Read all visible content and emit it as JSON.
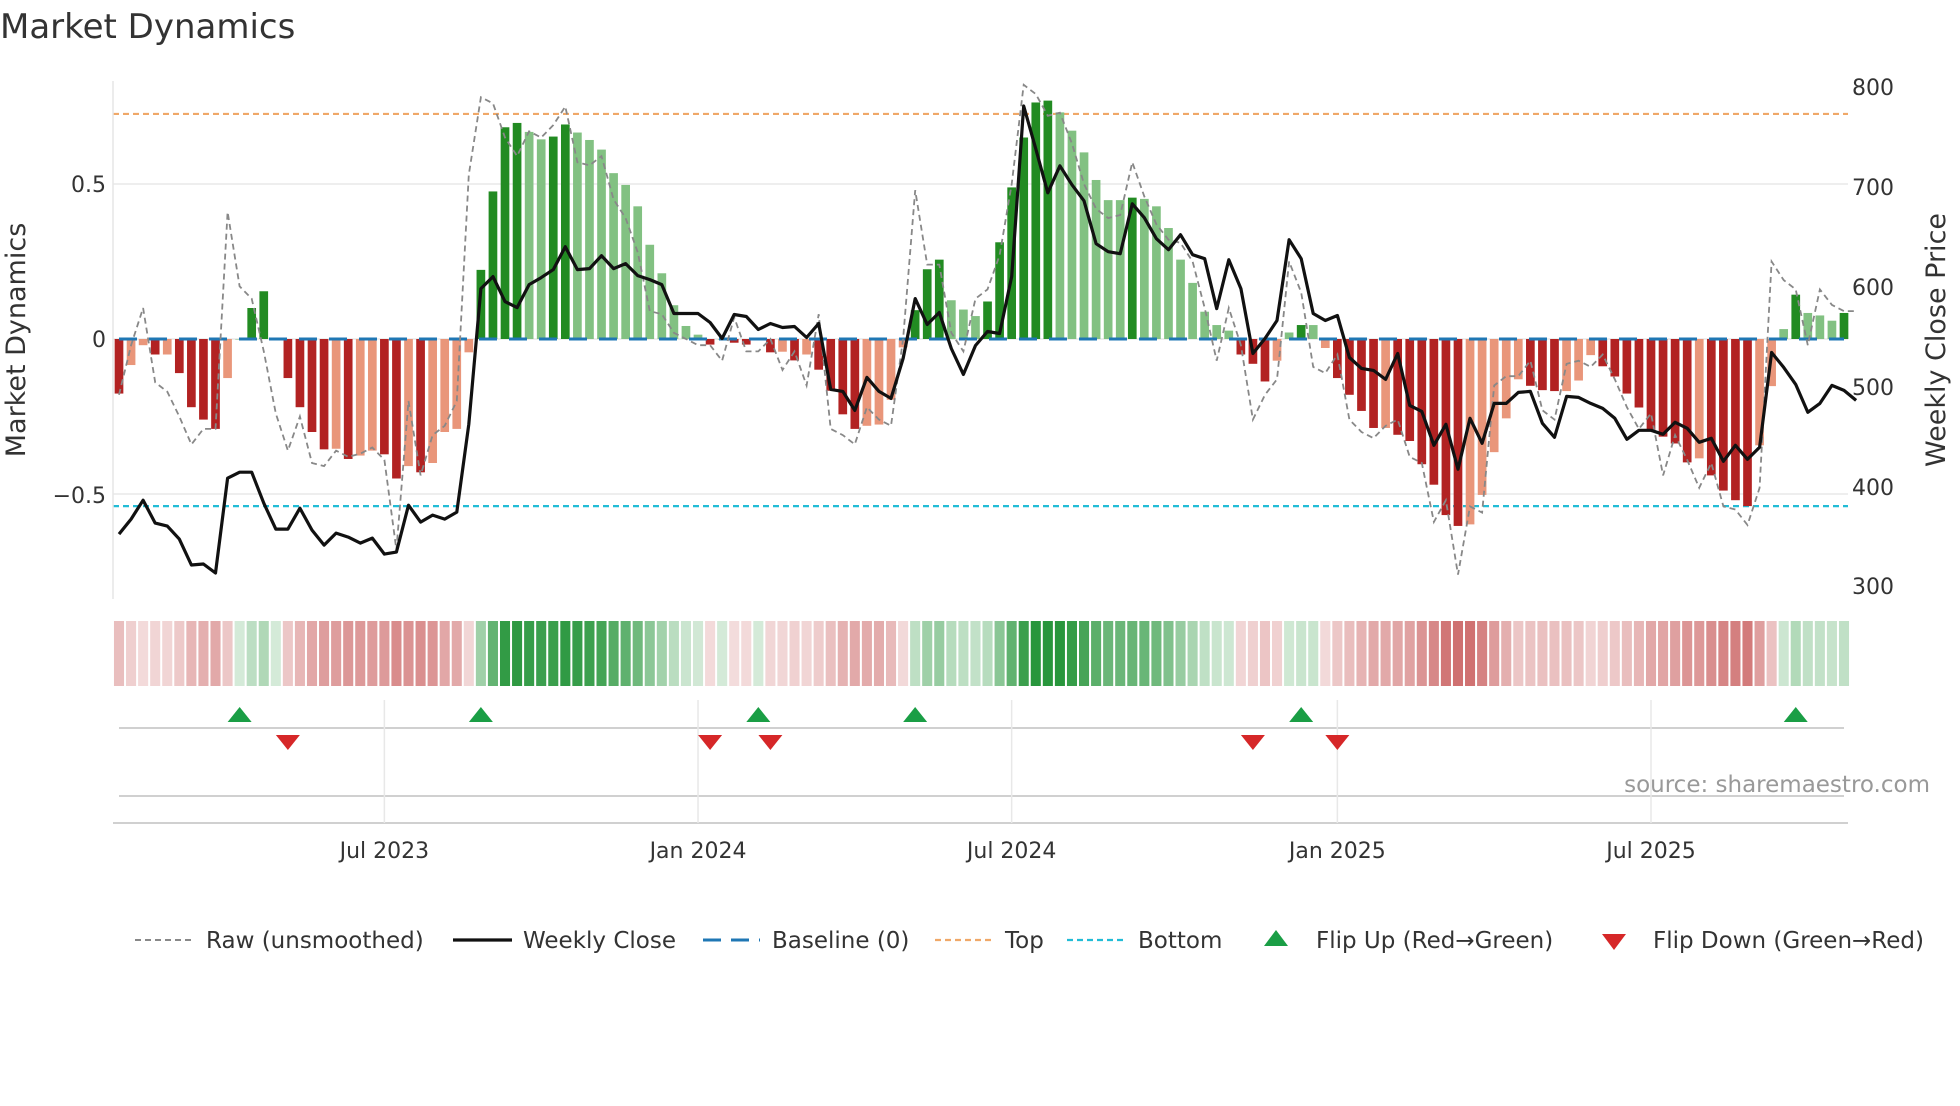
{
  "title": "Market Dynamics",
  "source": "source: sharemaestro.com",
  "colors": {
    "dark_green": "#228b22",
    "light_green": "#82c182",
    "dark_red": "#b22222",
    "light_red": "#e9967a",
    "baseline": "#1f77b4",
    "top": "#f0a868",
    "bottom": "#22bcd6",
    "flip_up": "#1a9e45",
    "flip_down": "#d62728",
    "close": "#111111",
    "raw": "#888888"
  },
  "chart_data": {
    "type": "bar",
    "title": "Market Dynamics",
    "ylabel": "Market Dynamics",
    "y2label": "Weekly Close Price",
    "ylim": [
      -0.84,
      0.83
    ],
    "y2lim": [
      300,
      800
    ],
    "yticks": [
      "0.5",
      "0",
      "−0.5"
    ],
    "ytick_values": [
      0.5,
      0,
      -0.5
    ],
    "y2ticks": [
      "800",
      "700",
      "600",
      "500",
      "400",
      "300"
    ],
    "xticks": [
      "Jul 2023",
      "Jan 2024",
      "Jul 2024",
      "Jan 2025",
      "Jul 2025"
    ],
    "xtick_bar_index": [
      22,
      48,
      74,
      101,
      127
    ],
    "top_level": 0.726,
    "bottom_level": -0.539,
    "baseline": 0,
    "values": [
      -0.176,
      -0.084,
      -0.02,
      -0.05,
      -0.05,
      -0.11,
      -0.22,
      -0.26,
      -0.29,
      -0.126,
      0.0,
      0.1,
      0.154,
      0.0,
      -0.126,
      -0.22,
      -0.3,
      -0.356,
      -0.354,
      -0.387,
      -0.376,
      -0.36,
      -0.372,
      -0.45,
      -0.41,
      -0.43,
      -0.4,
      -0.3,
      -0.29,
      -0.043,
      0.223,
      0.476,
      0.683,
      0.697,
      0.668,
      0.644,
      0.653,
      0.692,
      0.666,
      0.642,
      0.611,
      0.535,
      0.497,
      0.428,
      0.304,
      0.212,
      0.109,
      0.042,
      0.014,
      -0.018,
      0.0,
      -0.012,
      -0.018,
      0.0,
      -0.043,
      -0.041,
      -0.069,
      -0.05,
      -0.099,
      -0.167,
      -0.243,
      -0.29,
      -0.28,
      -0.276,
      -0.196,
      -0.027,
      0.093,
      0.225,
      0.256,
      0.125,
      0.095,
      0.074,
      0.121,
      0.312,
      0.489,
      0.65,
      0.763,
      0.769,
      0.731,
      0.672,
      0.602,
      0.513,
      0.448,
      0.448,
      0.456,
      0.452,
      0.428,
      0.358,
      0.256,
      0.181,
      0.088,
      0.045,
      0.027,
      -0.05,
      -0.08,
      -0.137,
      -0.07,
      0.021,
      0.045,
      0.045,
      -0.029,
      -0.126,
      -0.18,
      -0.232,
      -0.287,
      -0.287,
      -0.309,
      -0.329,
      -0.404,
      -0.47,
      -0.568,
      -0.603,
      -0.598,
      -0.503,
      -0.365,
      -0.256,
      -0.13,
      -0.151,
      -0.165,
      -0.168,
      -0.168,
      -0.134,
      -0.052,
      -0.088,
      -0.121,
      -0.176,
      -0.221,
      -0.298,
      -0.315,
      -0.337,
      -0.398,
      -0.385,
      -0.44,
      -0.489,
      -0.52,
      -0.539,
      -0.343,
      -0.152,
      0.032,
      0.143,
      0.084,
      0.076,
      0.059,
      0.084
    ],
    "raw": [
      -0.18,
      -0.02,
      0.1,
      -0.14,
      -0.17,
      -0.25,
      -0.34,
      -0.29,
      -0.29,
      0.41,
      0.17,
      0.13,
      -0.04,
      -0.24,
      -0.36,
      -0.25,
      -0.4,
      -0.41,
      -0.36,
      -0.38,
      -0.37,
      -0.35,
      -0.39,
      -0.68,
      -0.2,
      -0.44,
      -0.31,
      -0.28,
      -0.2,
      0.53,
      0.78,
      0.76,
      0.65,
      0.59,
      0.67,
      0.65,
      0.69,
      0.75,
      0.57,
      0.56,
      0.59,
      0.45,
      0.39,
      0.28,
      0.09,
      0.08,
      0.02,
      0.0,
      -0.02,
      -0.02,
      -0.07,
      0.07,
      -0.04,
      -0.04,
      0.0,
      -0.1,
      -0.04,
      -0.15,
      0.08,
      -0.29,
      -0.31,
      -0.34,
      -0.22,
      -0.26,
      -0.28,
      0.0,
      0.48,
      0.24,
      0.24,
      0.02,
      -0.04,
      0.13,
      0.16,
      0.27,
      0.5,
      0.82,
      0.79,
      0.72,
      0.73,
      0.63,
      0.5,
      0.42,
      0.39,
      0.4,
      0.57,
      0.46,
      0.37,
      0.32,
      0.31,
      0.25,
      0.1,
      -0.07,
      0.1,
      -0.02,
      -0.26,
      -0.18,
      -0.13,
      0.25,
      0.15,
      -0.09,
      -0.11,
      -0.05,
      -0.26,
      -0.3,
      -0.32,
      -0.28,
      -0.26,
      -0.38,
      -0.4,
      -0.59,
      -0.52,
      -0.76,
      -0.54,
      -0.56,
      -0.15,
      -0.12,
      -0.12,
      -0.07,
      -0.23,
      -0.26,
      -0.08,
      -0.07,
      -0.09,
      -0.05,
      -0.13,
      -0.22,
      -0.29,
      -0.24,
      -0.44,
      -0.31,
      -0.39,
      -0.48,
      -0.4,
      -0.54,
      -0.55,
      -0.6,
      -0.48,
      0.25,
      0.19,
      0.16,
      -0.02,
      0.16,
      0.11,
      0.09,
      0.09
    ],
    "weekly_close": [
      352,
      367,
      386,
      363,
      360,
      347,
      321,
      322,
      313,
      408,
      414,
      414,
      383,
      357,
      357,
      378,
      356,
      341,
      353,
      349,
      343,
      348,
      332,
      334,
      381,
      364,
      371,
      367,
      374,
      462,
      598,
      610,
      585,
      579,
      602,
      609,
      617,
      640,
      617,
      618,
      631,
      618,
      623,
      611,
      607,
      602,
      573,
      573,
      573,
      564,
      548,
      572,
      570,
      557,
      563,
      559,
      560,
      549,
      563,
      497,
      495,
      476,
      509,
      495,
      488,
      528,
      588,
      562,
      574,
      538,
      512,
      541,
      555,
      553,
      610,
      781,
      738,
      694,
      721,
      702,
      686,
      643,
      635,
      633,
      683,
      669,
      648,
      637,
      652,
      632,
      628,
      578,
      627,
      598,
      533,
      548,
      566,
      647,
      628,
      573,
      566,
      571,
      529,
      518,
      516,
      507,
      533,
      481,
      475,
      441,
      462,
      417,
      468,
      443,
      483,
      483,
      494,
      495,
      463,
      449,
      490,
      489,
      483,
      478,
      468,
      447,
      456,
      456,
      452,
      464,
      458,
      444,
      448,
      425,
      441,
      427,
      439,
      534,
      519,
      502,
      474,
      483,
      501,
      496,
      486
    ],
    "flip_up_index": [
      10,
      30,
      53,
      66,
      98,
      139
    ],
    "flip_down_index": [
      14,
      49,
      54,
      94,
      101
    ],
    "legend": {
      "placement": "bottom",
      "raw": "Raw (unsmoothed)",
      "close": "Weekly Close",
      "baseline": "Baseline (0)",
      "top": "Top",
      "bottom": "Bottom",
      "flip_up": "Flip Up (Red→Green)",
      "flip_down": "Flip Down (Green→Red)"
    }
  }
}
